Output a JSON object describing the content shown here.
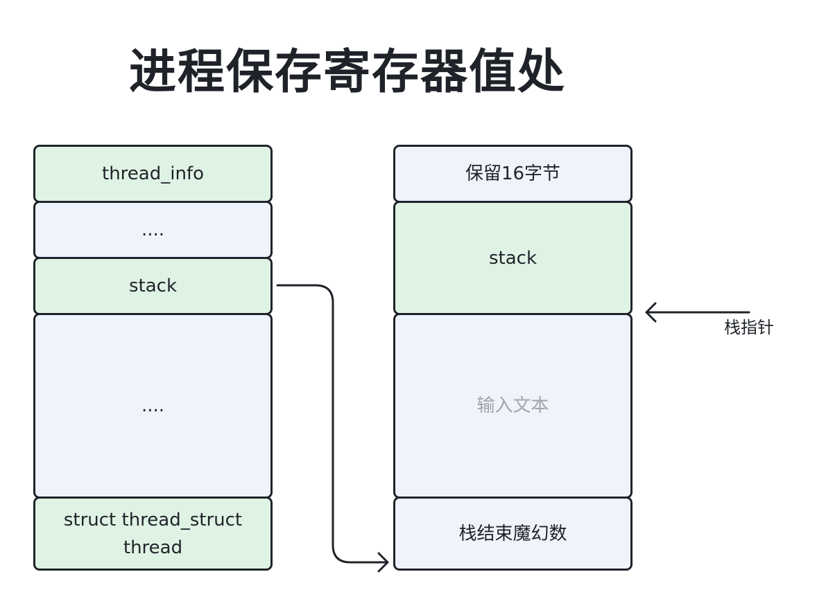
{
  "title": "进程保存寄存器值处",
  "left_column": {
    "blocks": [
      {
        "label": "thread_info"
      },
      {
        "label": "...."
      },
      {
        "label": "stack"
      },
      {
        "label": "...."
      },
      {
        "label_line1": "struct thread_struct",
        "label_line2": "thread"
      }
    ]
  },
  "right_column": {
    "blocks": [
      {
        "label": "保留16字节"
      },
      {
        "label": "stack"
      },
      {
        "placeholder": "输入文本"
      },
      {
        "label": "栈结束魔幻数"
      }
    ]
  },
  "stack_pointer_label": "栈指针",
  "colors": {
    "green_fill": "#dff3e4",
    "blue_fill": "#eef3fc",
    "stroke": "#1f2329",
    "placeholder_text": "#a1a4a9"
  }
}
